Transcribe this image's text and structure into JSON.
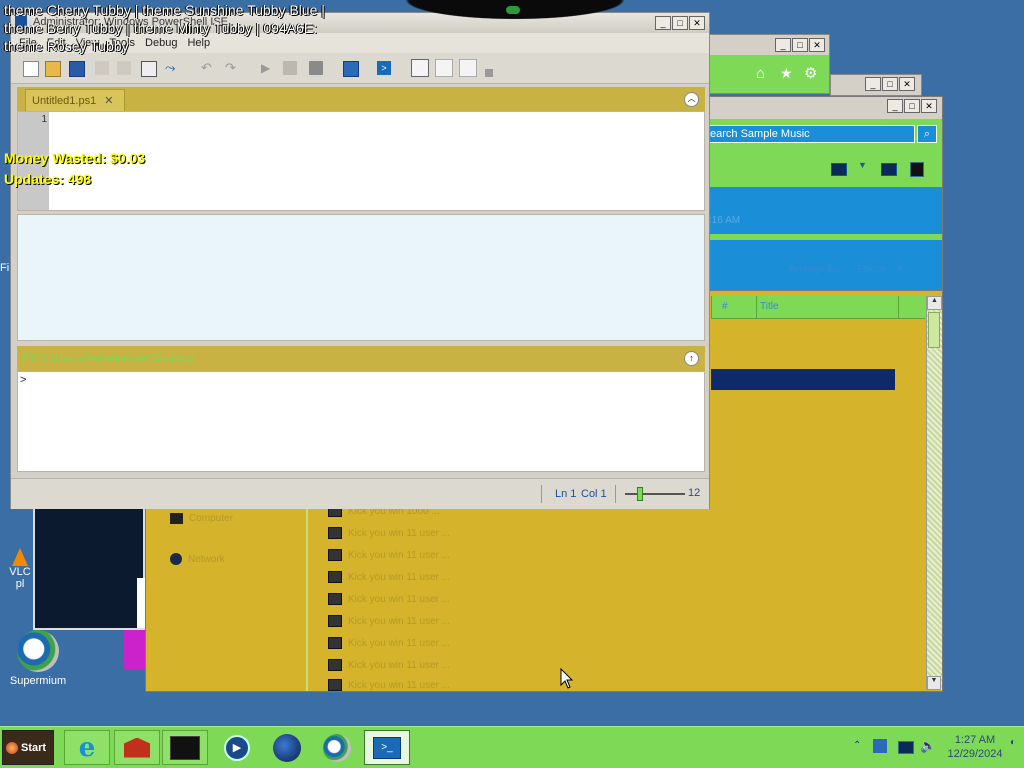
{
  "overlay": {
    "line1": "theme Cherry Tubby | theme Sunshine Tubby Blue |",
    "line2": "theme Berry Tubby | theme Minty Tubby | 094A6E:",
    "line3": "theme Rosey Tubby"
  },
  "stats": {
    "money": "Money Wasted: $0.03",
    "updates": "Updates: 498"
  },
  "ise": {
    "title": "Administrator: Windows PowerShell ISE",
    "menu": [
      "File",
      "Edit",
      "View",
      "Tools",
      "Debug",
      "Help"
    ],
    "tab_label": "Untitled1.ps1",
    "line_number": "1",
    "command_pane_title": "PS C:\\Users\\Administrator\\Desktop",
    "prompt": ">",
    "status_ln": "Ln 1",
    "status_col": "Col 1",
    "zoom_value": "12"
  },
  "explorer": {
    "search_placeholder": "earch Sample Music",
    "time_fragment": ":16 AM",
    "arrange_label": "Arrange by:",
    "arrange_value": "Folder",
    "col_hash": "#",
    "col_title": "Title",
    "nav_computer": "Computer",
    "nav_network": "Network",
    "rows": [
      "Kick you win 1000 ...",
      "Kick you win 11 user ...",
      "Kick you win 11 user ...",
      "Kick you win 11 user ...",
      "Kick you win 11 user ...",
      "Kick you win 11 user ...",
      "Kick you win 11 user ...",
      "Kick you win 11 user ...",
      "Kick you win 11 user ..."
    ]
  },
  "desktop": {
    "icon_fr": "Fi",
    "icon_vlc": "VLC\npl",
    "icon_supermium": "Supermium"
  },
  "taskbar": {
    "start_label": "Start",
    "clock_time": "1:27 AM",
    "clock_date": "12/29/2024"
  },
  "colors": {
    "desktop_bg": "#3a6ea5",
    "taskbar_green": "#7ed957",
    "explorer_mustard": "#d5b32a",
    "ise_yellow": "#c8b244",
    "header_blue": "#1a8fd8"
  }
}
